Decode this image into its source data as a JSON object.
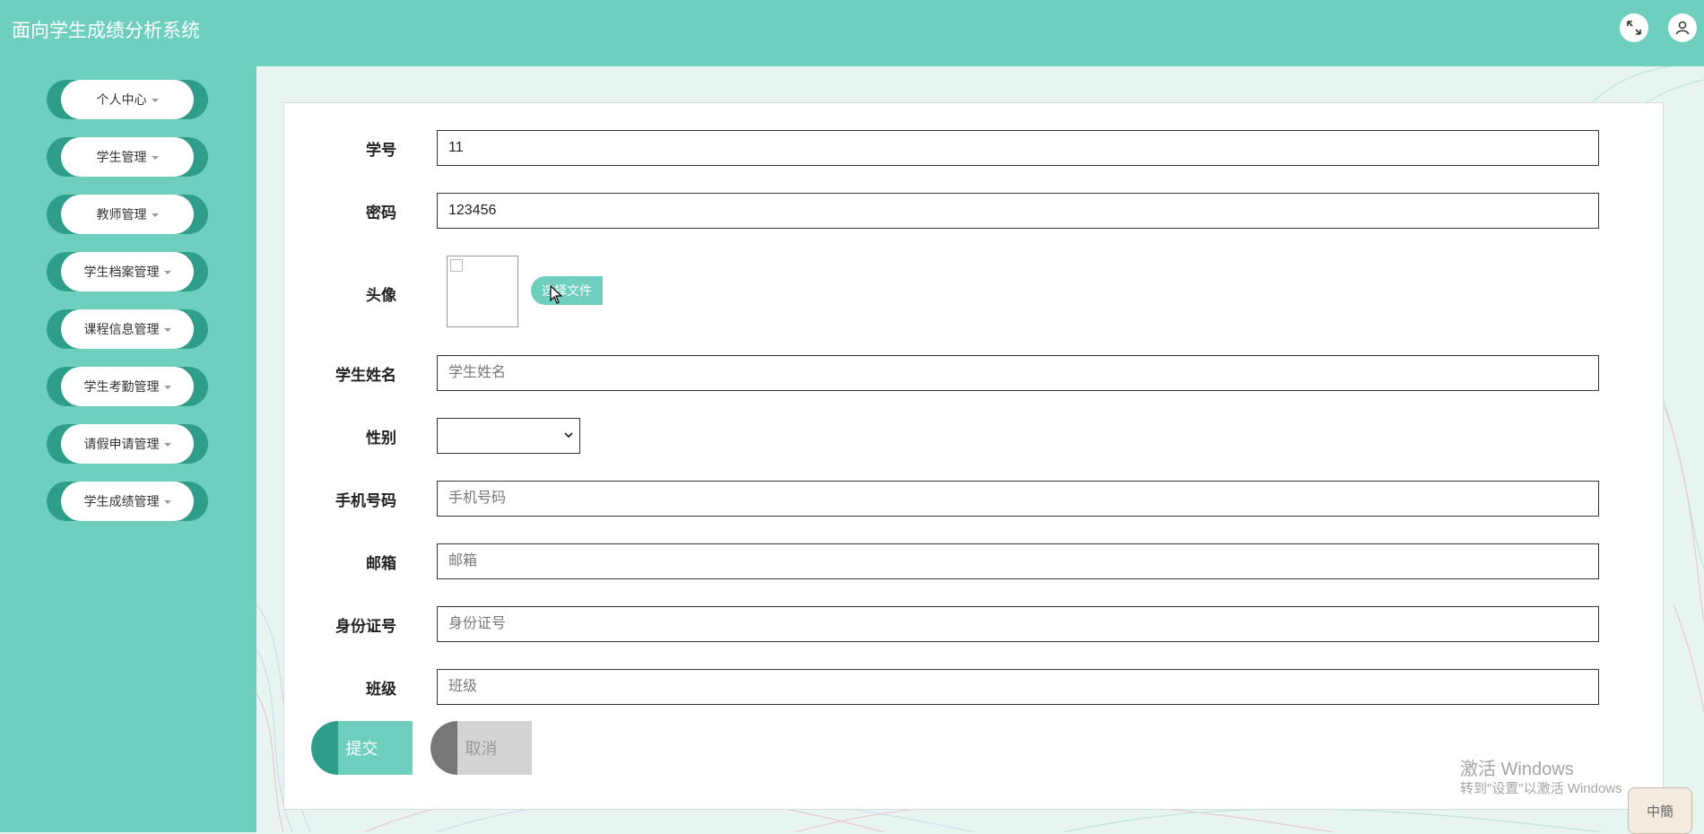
{
  "app": {
    "title": "面向学生成绩分析系统"
  },
  "header_icons": [
    "fullscreen-icon",
    "user-icon"
  ],
  "sidebar": {
    "items": [
      {
        "label": "个人中心"
      },
      {
        "label": "学生管理"
      },
      {
        "label": "教师管理"
      },
      {
        "label": "学生档案管理"
      },
      {
        "label": "课程信息管理"
      },
      {
        "label": "学生考勤管理"
      },
      {
        "label": "请假申请管理"
      },
      {
        "label": "学生成绩管理"
      }
    ]
  },
  "form": {
    "student_id": {
      "label": "学号",
      "value": "11"
    },
    "password": {
      "label": "密码",
      "value": "123456"
    },
    "avatar": {
      "label": "头像",
      "upload_label": "选择文件"
    },
    "name": {
      "label": "学生姓名",
      "placeholder": "学生姓名"
    },
    "gender": {
      "label": "性别",
      "value": ""
    },
    "phone": {
      "label": "手机号码",
      "placeholder": "手机号码"
    },
    "email": {
      "label": "邮箱",
      "placeholder": "邮箱"
    },
    "id_card": {
      "label": "身份证号",
      "placeholder": "身份证号"
    },
    "class": {
      "label": "班级",
      "placeholder": "班级"
    },
    "submit_label": "提交",
    "cancel_label": "取消"
  },
  "overlay": {
    "watermark_title": "激活 Windows",
    "watermark_sub": "转到\"设置\"以激活 Windows",
    "ime_label": "中簡"
  },
  "colors": {
    "primary": "#6fcfbf",
    "primary_dark": "#2e9e8a",
    "cancel_bg": "#d3d3d3",
    "cancel_dark": "#777777",
    "background": "#e8f4ef"
  }
}
